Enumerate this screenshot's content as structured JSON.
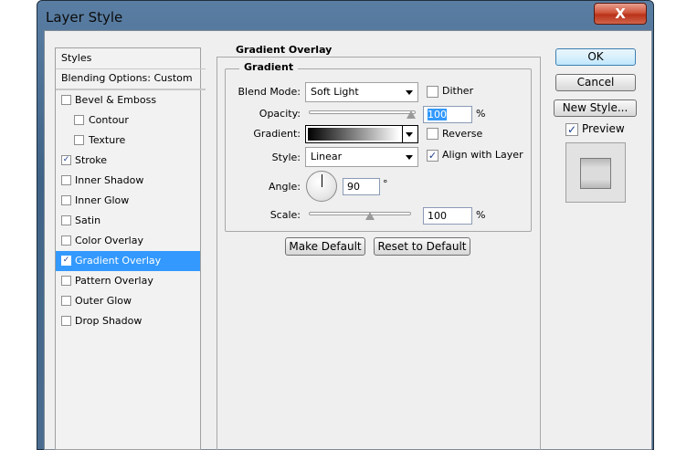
{
  "window": {
    "title": "Layer Style",
    "close_glyph": "X"
  },
  "styles_panel": {
    "header": "Styles",
    "blending_options": "Blending Options: Custom",
    "items": [
      {
        "label": "Bevel & Emboss",
        "checked": false,
        "indent": false,
        "selected": false
      },
      {
        "label": "Contour",
        "checked": false,
        "indent": true,
        "selected": false
      },
      {
        "label": "Texture",
        "checked": false,
        "indent": true,
        "selected": false
      },
      {
        "label": "Stroke",
        "checked": true,
        "indent": false,
        "selected": false
      },
      {
        "label": "Inner Shadow",
        "checked": false,
        "indent": false,
        "selected": false
      },
      {
        "label": "Inner Glow",
        "checked": false,
        "indent": false,
        "selected": false
      },
      {
        "label": "Satin",
        "checked": false,
        "indent": false,
        "selected": false
      },
      {
        "label": "Color Overlay",
        "checked": false,
        "indent": false,
        "selected": false
      },
      {
        "label": "Gradient Overlay",
        "checked": true,
        "indent": false,
        "selected": true
      },
      {
        "label": "Pattern Overlay",
        "checked": false,
        "indent": false,
        "selected": false
      },
      {
        "label": "Outer Glow",
        "checked": false,
        "indent": false,
        "selected": false
      },
      {
        "label": "Drop Shadow",
        "checked": false,
        "indent": false,
        "selected": false
      }
    ]
  },
  "gradient_overlay": {
    "section_title": "Gradient Overlay",
    "group_title": "Gradient",
    "blend_mode": {
      "label": "Blend Mode:",
      "value": "Soft Light"
    },
    "dither": {
      "label": "Dither",
      "checked": false
    },
    "opacity": {
      "label": "Opacity:",
      "value": "100",
      "unit": "%",
      "level": 1.0
    },
    "gradient": {
      "label": "Gradient:"
    },
    "reverse": {
      "label": "Reverse",
      "checked": false
    },
    "style": {
      "label": "Style:",
      "value": "Linear"
    },
    "align_with_layer": {
      "label": "Align with Layer",
      "checked": true
    },
    "angle": {
      "label": "Angle:",
      "value": "90",
      "unit": "°"
    },
    "scale": {
      "label": "Scale:",
      "value": "100",
      "unit": "%",
      "level": 0.6
    },
    "make_default": "Make Default",
    "reset_to_default": "Reset to Default"
  },
  "buttons": {
    "ok": "OK",
    "cancel": "Cancel",
    "new_style": "New Style...",
    "preview": {
      "label": "Preview",
      "checked": true
    }
  },
  "colors": {
    "selection": "#3399ff",
    "dialog_bg": "#efefef"
  }
}
